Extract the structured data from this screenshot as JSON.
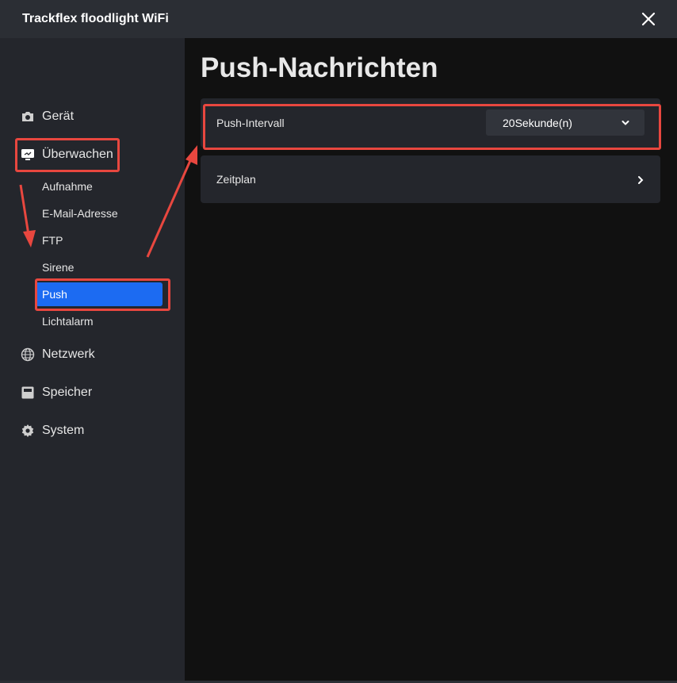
{
  "window": {
    "title": "Trackflex floodlight WiFi"
  },
  "sidebar": {
    "items": [
      {
        "label": "Gerät",
        "icon": "camera-icon"
      },
      {
        "label": "Überwachen",
        "icon": "monitor-icon"
      },
      {
        "label": "Netzwerk",
        "icon": "globe-icon"
      },
      {
        "label": "Speicher",
        "icon": "storage-icon"
      },
      {
        "label": "System",
        "icon": "gear-icon"
      }
    ],
    "sub_items": [
      {
        "label": "Aufnahme"
      },
      {
        "label": "E-Mail-Adresse"
      },
      {
        "label": "FTP"
      },
      {
        "label": "Sirene"
      },
      {
        "label": "Push",
        "active": true
      },
      {
        "label": "Lichtalarm"
      }
    ]
  },
  "main": {
    "title": "Push-Nachrichten",
    "rows": [
      {
        "label": "Push-Intervall",
        "value": "20Sekunde(n)"
      },
      {
        "label": "Zeitplan"
      }
    ]
  },
  "colors": {
    "accent": "#1c6bf2",
    "annotation": "#e8473f",
    "sidebar_bg": "#24262c",
    "main_bg": "#111111",
    "titlebar_bg": "#2b2e34"
  }
}
